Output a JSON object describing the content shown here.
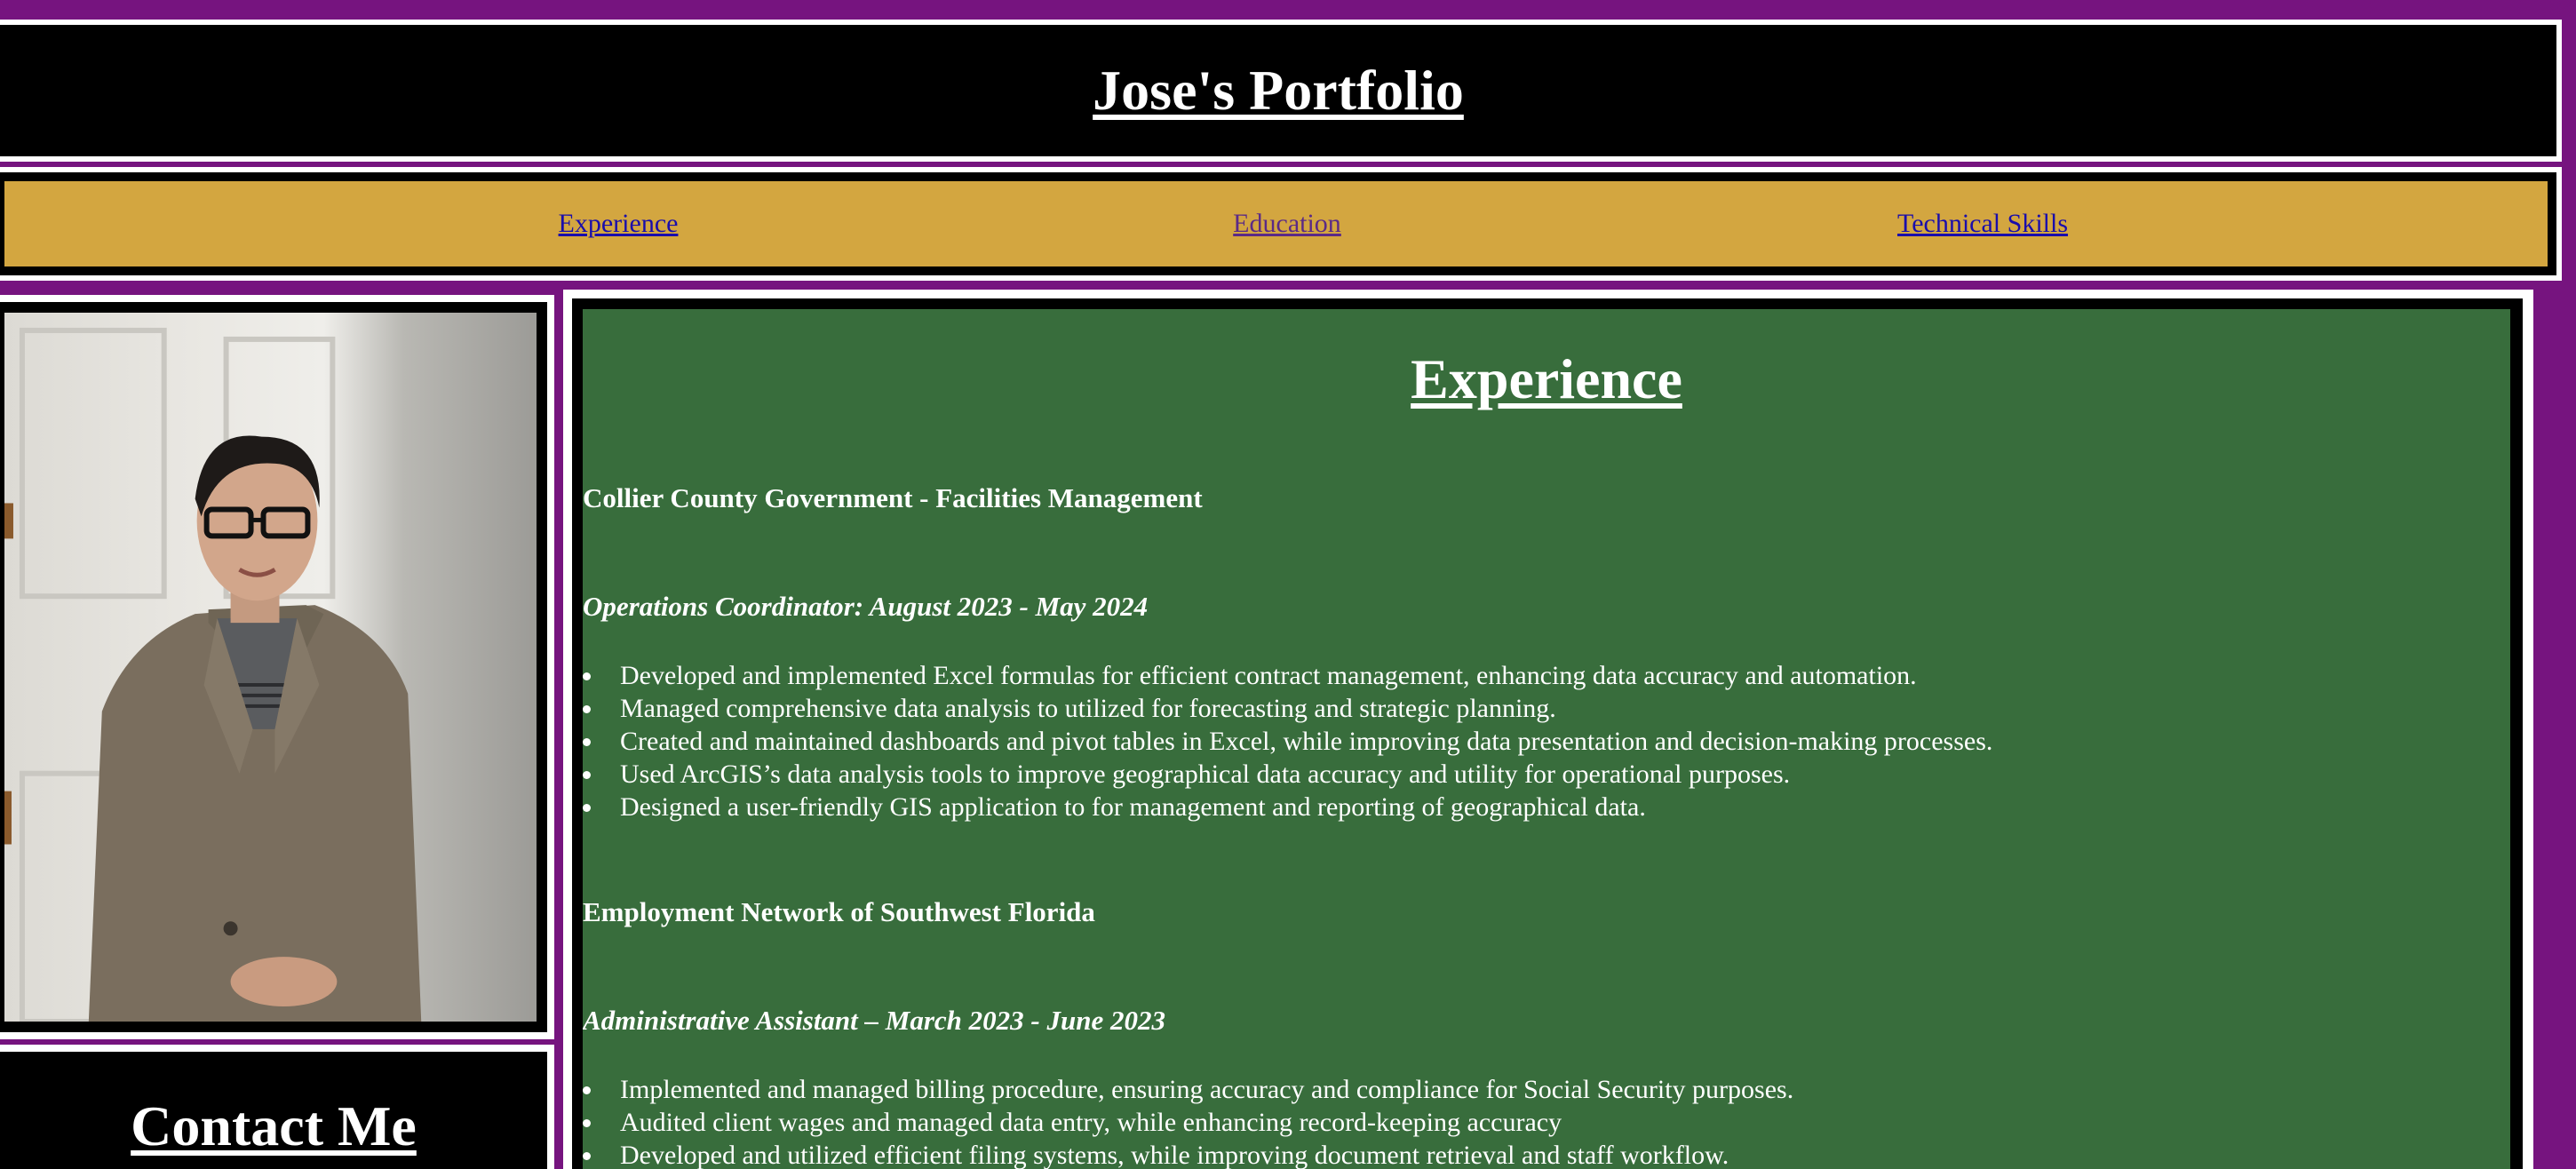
{
  "header": {
    "title": "Jose's Portfolio"
  },
  "nav": {
    "items": [
      {
        "label": "Experience"
      },
      {
        "label": "Education"
      },
      {
        "label": "Technical Skills"
      }
    ]
  },
  "sidebar": {
    "contact_heading": "Contact Me"
  },
  "main": {
    "heading": "Experience",
    "jobs": [
      {
        "organization": "Collier County Government - Facilities Management",
        "role": "Operations Coordinator: August 2023 - May 2024",
        "bullets": [
          "Developed and implemented Excel formulas for efficient contract management, enhancing data accuracy and automation.",
          "Managed comprehensive data analysis to utilized for forecasting and strategic planning.",
          "Created and maintained dashboards and pivot tables in Excel, while improving data presentation and decision-making processes.",
          "Used ArcGIS’s data analysis tools to improve geographical data accuracy and utility for operational purposes.",
          "Designed a user-friendly GIS application to for management and reporting of geographical data."
        ]
      },
      {
        "organization": "Employment Network of Southwest Florida",
        "role": "Administrative Assistant – March 2023 - June 2023",
        "bullets": [
          "Implemented and managed billing procedure, ensuring accuracy and compliance for Social Security purposes.",
          "Audited client wages and managed data entry, while enhancing record-keeping accuracy",
          "Developed and utilized efficient filing systems, while improving document retrieval and staff workflow."
        ]
      }
    ]
  },
  "colors": {
    "page_background": "#76147f",
    "header_background": "#000000",
    "nav_background": "#d3a640",
    "main_background": "#386d3c",
    "link": "#1a0dab",
    "visited_link": "#5b2a86"
  }
}
